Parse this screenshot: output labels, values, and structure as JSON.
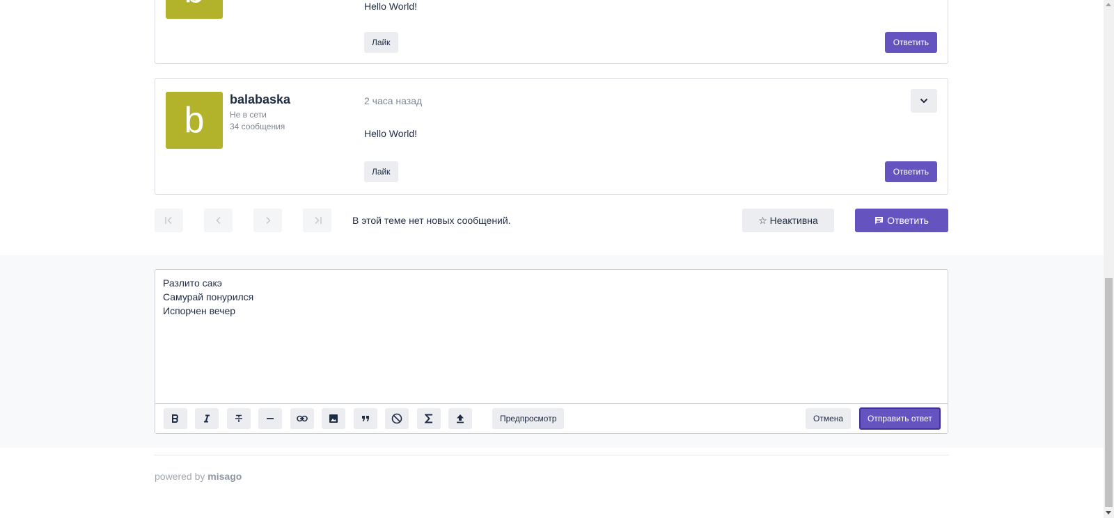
{
  "posts": [
    {
      "avatar_letter": "b",
      "body": "Hello World!",
      "like_label": "Лайк",
      "reply_label": "Ответить"
    },
    {
      "avatar_letter": "b",
      "username": "balabaska",
      "status": "Не в сети",
      "post_count": "34 сообщения",
      "time": "2 часа назад",
      "body": "Hello World!",
      "like_label": "Лайк",
      "reply_label": "Ответить"
    }
  ],
  "thread_toolbar": {
    "no_new_text": "В этой теме нет новых сообщений.",
    "subscribe_label": "☆ Неактивна",
    "reply_label": "Ответить"
  },
  "composer": {
    "lines": [
      "Разлито сакэ",
      "Самурай понурился",
      "Испорчен вечер"
    ],
    "preview_label": "Предпросмотр",
    "cancel_label": "Отмена",
    "submit_label": "Отправить ответ",
    "tools": [
      "bold-icon",
      "italic-icon",
      "strikethrough-icon",
      "horizontal-rule-icon",
      "link-icon",
      "image-icon",
      "quote-icon",
      "spoiler-icon",
      "math-icon",
      "upload-icon"
    ]
  },
  "footer": {
    "powered_prefix": "powered by",
    "brand": "misago"
  },
  "colors": {
    "accent": "#6554c0",
    "avatar": "#b2b32b",
    "text": "#1f2c44",
    "muted": "#7d8593"
  }
}
